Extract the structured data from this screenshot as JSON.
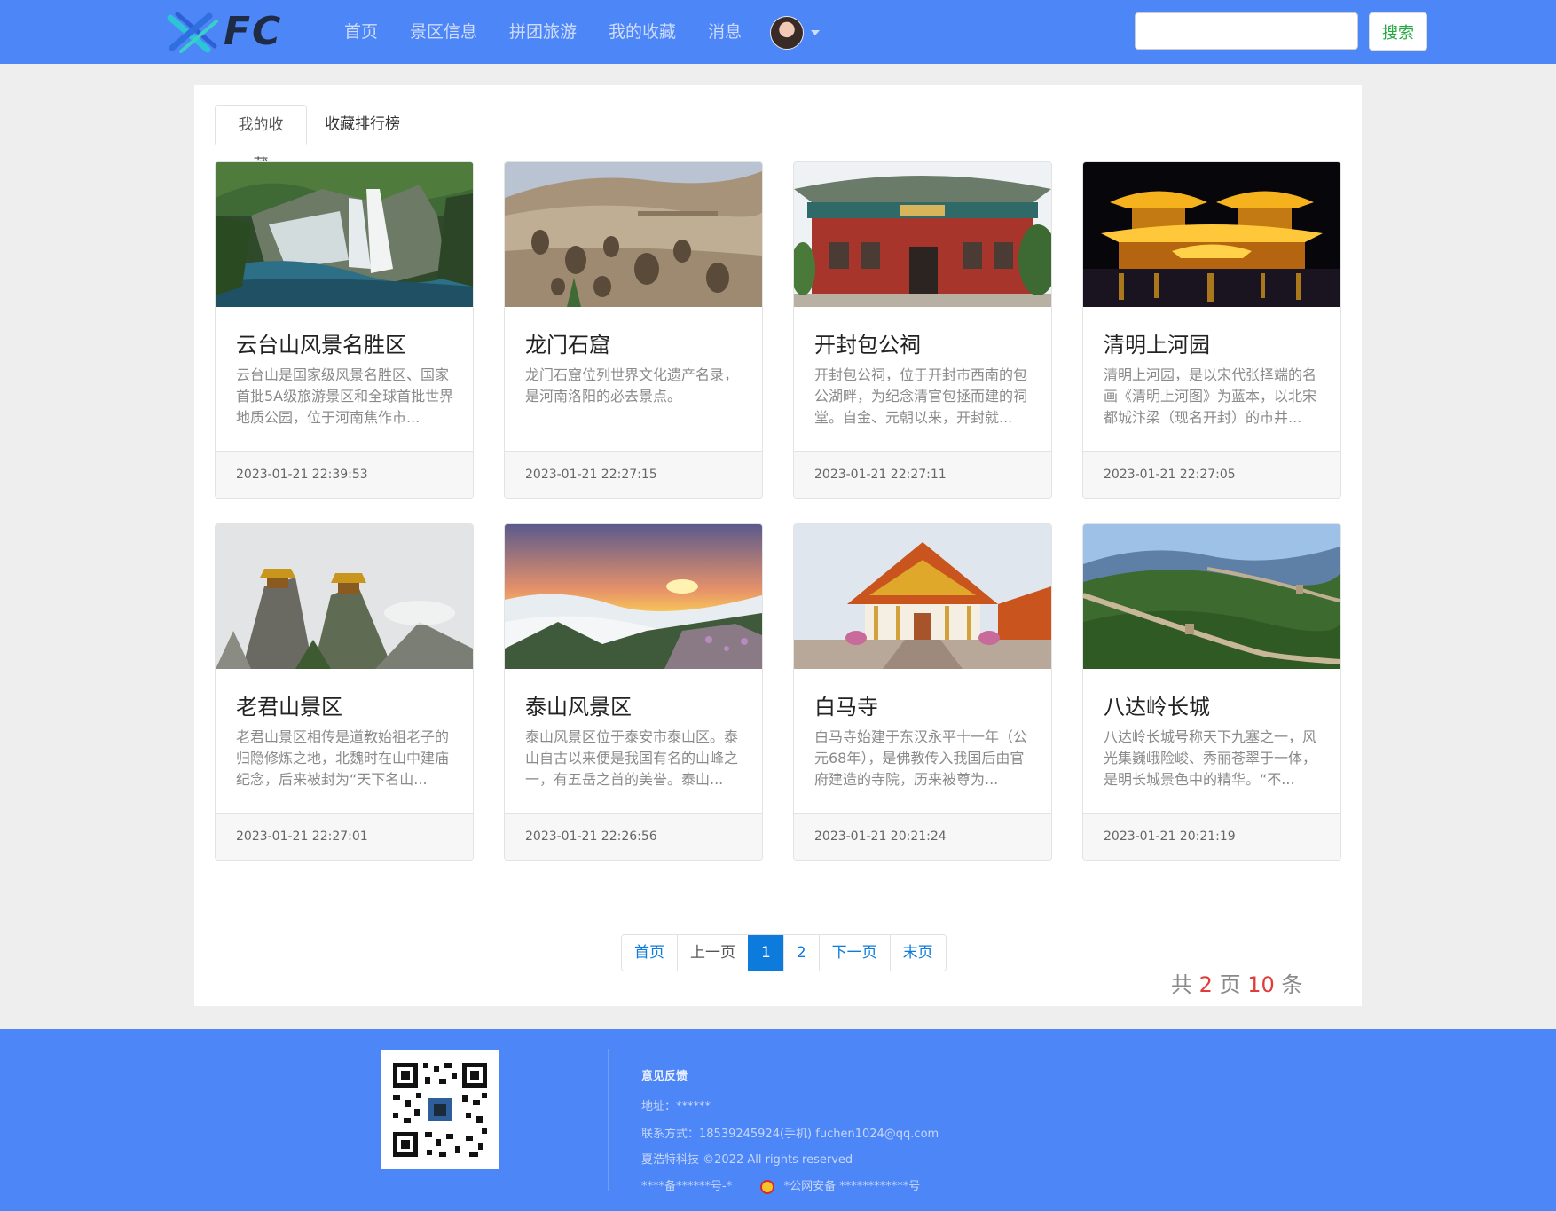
{
  "header": {
    "logo_text": "FC",
    "nav": [
      "首页",
      "景区信息",
      "拼团旅游",
      "我的收藏",
      "消息"
    ],
    "search_placeholder": "",
    "search_button": "搜索"
  },
  "tabs": [
    "我的收藏",
    "收藏排行榜"
  ],
  "cards": [
    {
      "title": "云台山风景名胜区",
      "desc": "云台山是国家级风景名胜区、国家首批5A级旅游景区和全球首批世界地质公园，位于河南焦作市...",
      "time": "2023-01-21 22:39:53",
      "image": "waterfall"
    },
    {
      "title": "龙门石窟",
      "desc": "龙门石窟位列世界文化遗产名录，是河南洛阳的必去景点。",
      "time": "2023-01-21 22:27:15",
      "image": "grottoes"
    },
    {
      "title": "开封包公祠",
      "desc": "开封包公祠，位于开封市西南的包公湖畔，为纪念清官包拯而建的祠堂。自金、元朝以来，开封就...",
      "time": "2023-01-21 22:27:11",
      "image": "temple-hall"
    },
    {
      "title": "清明上河园",
      "desc": "清明上河园，是以宋代张择端的名画《清明上河图》为蓝本，以北宋都城汴梁（现名开封）的市井...",
      "time": "2023-01-21 22:27:05",
      "image": "night-palace"
    },
    {
      "title": "老君山景区",
      "desc": "老君山景区相传是道教始祖老子的归隐修炼之地，北魏时在山中建庙纪念，后来被封为“天下名山...",
      "time": "2023-01-21 22:27:01",
      "image": "mountain-pavilions"
    },
    {
      "title": "泰山风景区",
      "desc": "泰山风景区位于泰安市泰山区。泰山自古以来便是我国有名的山峰之一，有五岳之首的美誉。泰山...",
      "time": "2023-01-21 22:26:56",
      "image": "sunrise-clouds"
    },
    {
      "title": "白马寺",
      "desc": "白马寺始建于东汉永平十一年（公元68年），是佛教传入我国后由官府建造的寺院，历来被尊为...",
      "time": "2023-01-21 20:21:24",
      "image": "golden-temple"
    },
    {
      "title": "八达岭长城",
      "desc": "八达岭长城号称天下九塞之一，风光集巍峨险峻、秀丽苍翠于一体，是明长城景色中的精华。“不...",
      "time": "2023-01-21 20:21:19",
      "image": "great-wall"
    }
  ],
  "pagination": {
    "first": "首页",
    "prev": "上一页",
    "pages": [
      "1",
      "2"
    ],
    "current": "1",
    "next": "下一页",
    "last": "末页",
    "total_prefix": "共",
    "total_pages": "2",
    "total_mid": "页",
    "total_items": "10",
    "total_suffix": "条"
  },
  "footer": {
    "title": "意见反馈",
    "address": "地址：******",
    "contact": "联系方式：18539245924(手机)    fuchen1024@qq.com",
    "copyright": "夏浩特科技 ©2022 All rights reserved",
    "icp": "****备******号-*",
    "police": "*公网安备 ************号"
  },
  "colors": {
    "brand_blue": "#4d86f7",
    "accent_red": "#e03c3c",
    "link_blue": "#0d7bdc",
    "search_green": "#28a745"
  }
}
